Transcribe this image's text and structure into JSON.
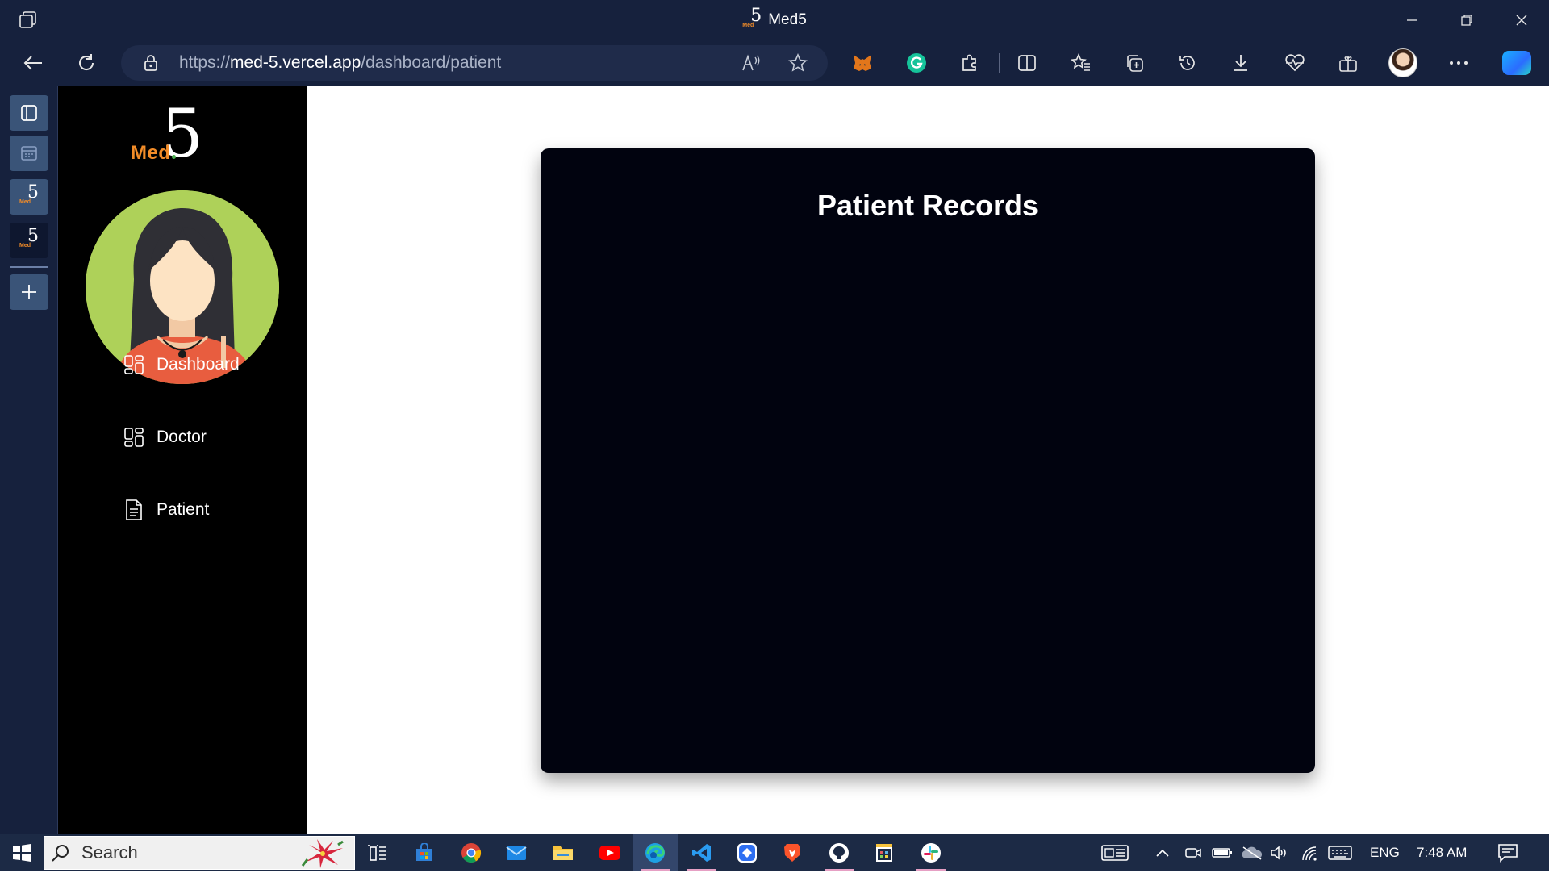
{
  "browser": {
    "window_title": "Med5",
    "url_scheme": "https://",
    "url_host": "med-5.vercel.app",
    "url_path": "/dashboard/patient"
  },
  "app": {
    "logo_text": "Med",
    "logo_numeral": "5",
    "nav": [
      {
        "label": "Dashboard",
        "icon": "dashboard-grid-icon"
      },
      {
        "label": "Doctor",
        "icon": "dashboard-grid-icon"
      },
      {
        "label": "Patient",
        "icon": "document-icon"
      }
    ],
    "colors": {
      "accent": "#f28c28",
      "avatar_bg": "#aed159",
      "card_bg": "#01030f",
      "sidebar_bg": "#000000"
    }
  },
  "main": {
    "card_title": "Patient Records"
  },
  "taskbar": {
    "search_placeholder": "Search",
    "language": "ENG",
    "time": "7:48 AM"
  }
}
